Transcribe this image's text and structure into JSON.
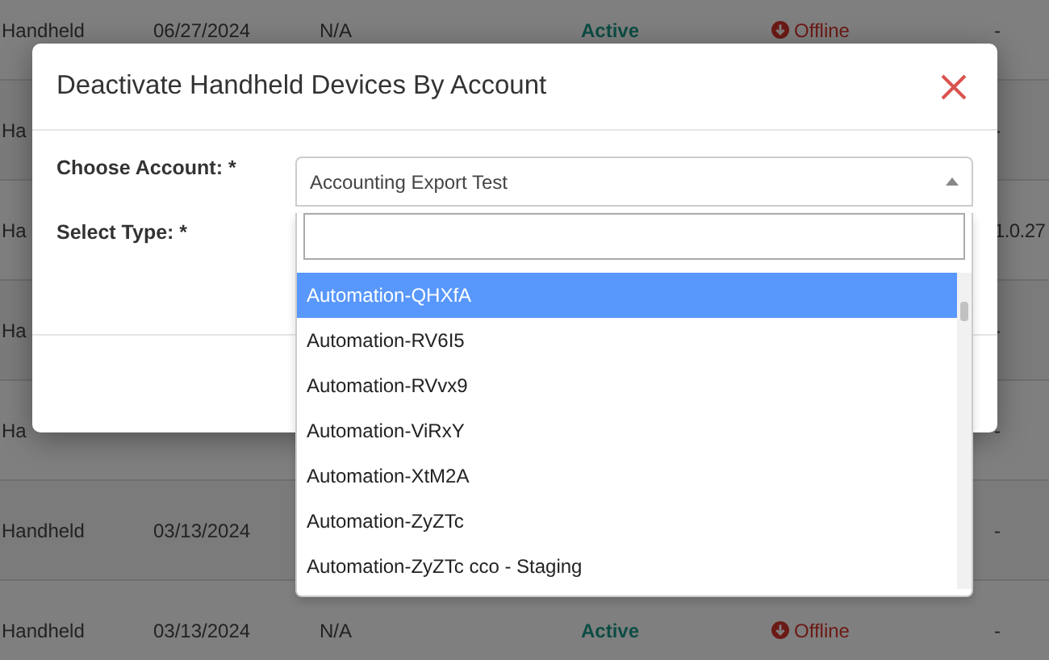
{
  "table": {
    "rows": [
      {
        "type": "Handheld",
        "date": "06/27/2024",
        "version": "N/A",
        "status": "Active",
        "connection": "Offline",
        "extra": "-"
      },
      {
        "type": "Ha",
        "extra": "-"
      },
      {
        "type": "Ha",
        "extra": "1.0.27"
      },
      {
        "type": "Ha",
        "extra": "-"
      },
      {
        "type": "Ha",
        "extra": "-"
      },
      {
        "type": "Handheld",
        "date": "03/13/2024",
        "extra": "-"
      },
      {
        "type": "Handheld",
        "date": "03/13/2024",
        "version": "N/A",
        "status": "Active",
        "connection": "Offline",
        "extra": "-"
      }
    ]
  },
  "dialog": {
    "title": "Deactivate Handheld Devices By Account",
    "fields": [
      {
        "label": "Choose Account: *",
        "value": "Accounting Export Test",
        "expanded": true
      },
      {
        "label": "Select Type: *"
      }
    ],
    "dropdown": {
      "options": [
        {
          "label": "Automation-QHXfA",
          "selected": true
        },
        {
          "label": "Automation-RV6I5",
          "selected": false
        },
        {
          "label": "Automation-RVvx9",
          "selected": false
        },
        {
          "label": "Automation-ViRxY",
          "selected": false
        },
        {
          "label": "Automation-XtM2A",
          "selected": false
        },
        {
          "label": "Automation-ZyZTc",
          "selected": false
        },
        {
          "label": "Automation-ZyZTc cco - Staging",
          "selected": false
        }
      ]
    }
  }
}
